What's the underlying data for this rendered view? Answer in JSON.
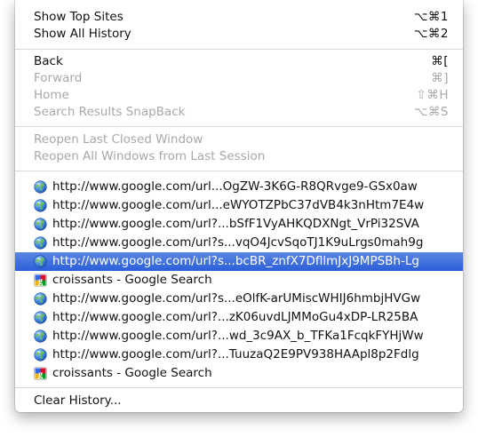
{
  "menu": {
    "top_sites": {
      "label": "Show Top Sites",
      "shortcut": "⌥⌘1"
    },
    "all_history": {
      "label": "Show All History",
      "shortcut": "⌥⌘2"
    },
    "back": {
      "label": "Back",
      "shortcut": "⌘["
    },
    "forward": {
      "label": "Forward",
      "shortcut": "⌘]"
    },
    "home": {
      "label": "Home",
      "shortcut": "⇧⌘H"
    },
    "snapback": {
      "label": "Search Results SnapBack",
      "shortcut": "⌥⌘S"
    },
    "reopen_window": {
      "label": "Reopen Last Closed Window"
    },
    "reopen_all": {
      "label": "Reopen All Windows from Last Session"
    },
    "history": [
      {
        "icon": "globe-icon",
        "label": "http://www.google.com/url...OgZW-3K6G-R8QRvge9-GSx0aw"
      },
      {
        "icon": "globe-icon",
        "label": "http://www.google.com/url...eWYOTZPbC37dVB4k3nHtm7E4w"
      },
      {
        "icon": "globe-icon",
        "label": "http://www.google.com/url?...bSfF1VyAHKQDXNgt_VrPi32SVA"
      },
      {
        "icon": "globe-icon",
        "label": "http://www.google.com/url?s...vqO4JcvSqoTJ1K9uLrgs0mah9g"
      },
      {
        "icon": "globe-icon",
        "label": "http://www.google.com/url?s...bcBR_znfX7DfllmJxJ9MPSBh-Lg",
        "selected": true
      },
      {
        "icon": "google-favicon-icon",
        "label": "croissants - Google Search"
      },
      {
        "icon": "globe-icon",
        "label": "http://www.google.com/url?s...eOlfK-arUMiscWHIJ6hmbjHVGw"
      },
      {
        "icon": "globe-icon",
        "label": "http://www.google.com/url?...zK06uvdLJMMoGu4xDP-LR25BA"
      },
      {
        "icon": "globe-icon",
        "label": "http://www.google.com/url?...wd_3c9AX_b_TFKa1FcqkFYHjWw"
      },
      {
        "icon": "globe-icon",
        "label": "http://www.google.com/url?...TuuzaQ2E9PV938HAApl8p2Fdlg"
      },
      {
        "icon": "google-favicon-icon",
        "label": "croissants - Google Search"
      }
    ],
    "clear_history": {
      "label": "Clear History..."
    }
  },
  "colors": {
    "selection": "#3a6be0",
    "disabled_text": "#a8a8a8",
    "separator": "#d9d9d9"
  }
}
